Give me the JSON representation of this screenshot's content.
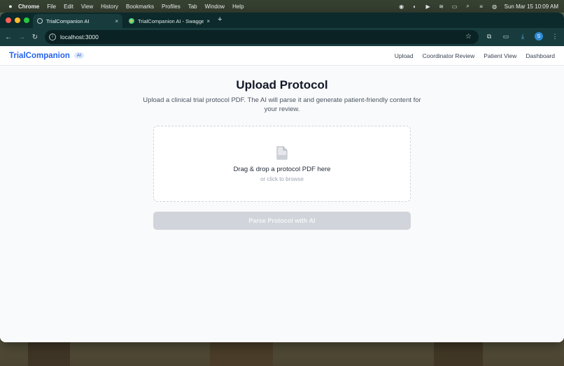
{
  "menubar": {
    "app": "Chrome",
    "items": [
      "File",
      "Edit",
      "View",
      "History",
      "Bookmarks",
      "Profiles",
      "Tab",
      "Window",
      "Help"
    ],
    "clock": "Sun Mar 15  10:09 AM"
  },
  "browser": {
    "tabs": [
      {
        "label": "TrialCompanion AI",
        "active": true
      },
      {
        "label": "TrialCompanion AI - Swagger",
        "active": false
      }
    ],
    "new_tab_icon": "+",
    "close_icon": "×",
    "url": "localhost:3000",
    "profile_initial": "S"
  },
  "app": {
    "brand": "TrialCompanion",
    "badge": "AI",
    "nav": [
      "Upload",
      "Coordinator Review",
      "Patient View",
      "Dashboard"
    ]
  },
  "main": {
    "title": "Upload Protocol",
    "subtitle": "Upload a clinical trial protocol PDF. The AI will parse it and generate patient-friendly content for your review.",
    "dropzone": {
      "primary": "Drag & drop a protocol PDF here",
      "secondary": "or click to browse"
    },
    "parse_button": "Parse Protocol with AI"
  },
  "colors": {
    "brand": "#2563eb",
    "button_disabled": "#d1d5db",
    "chrome_dark": "#183c3d"
  }
}
